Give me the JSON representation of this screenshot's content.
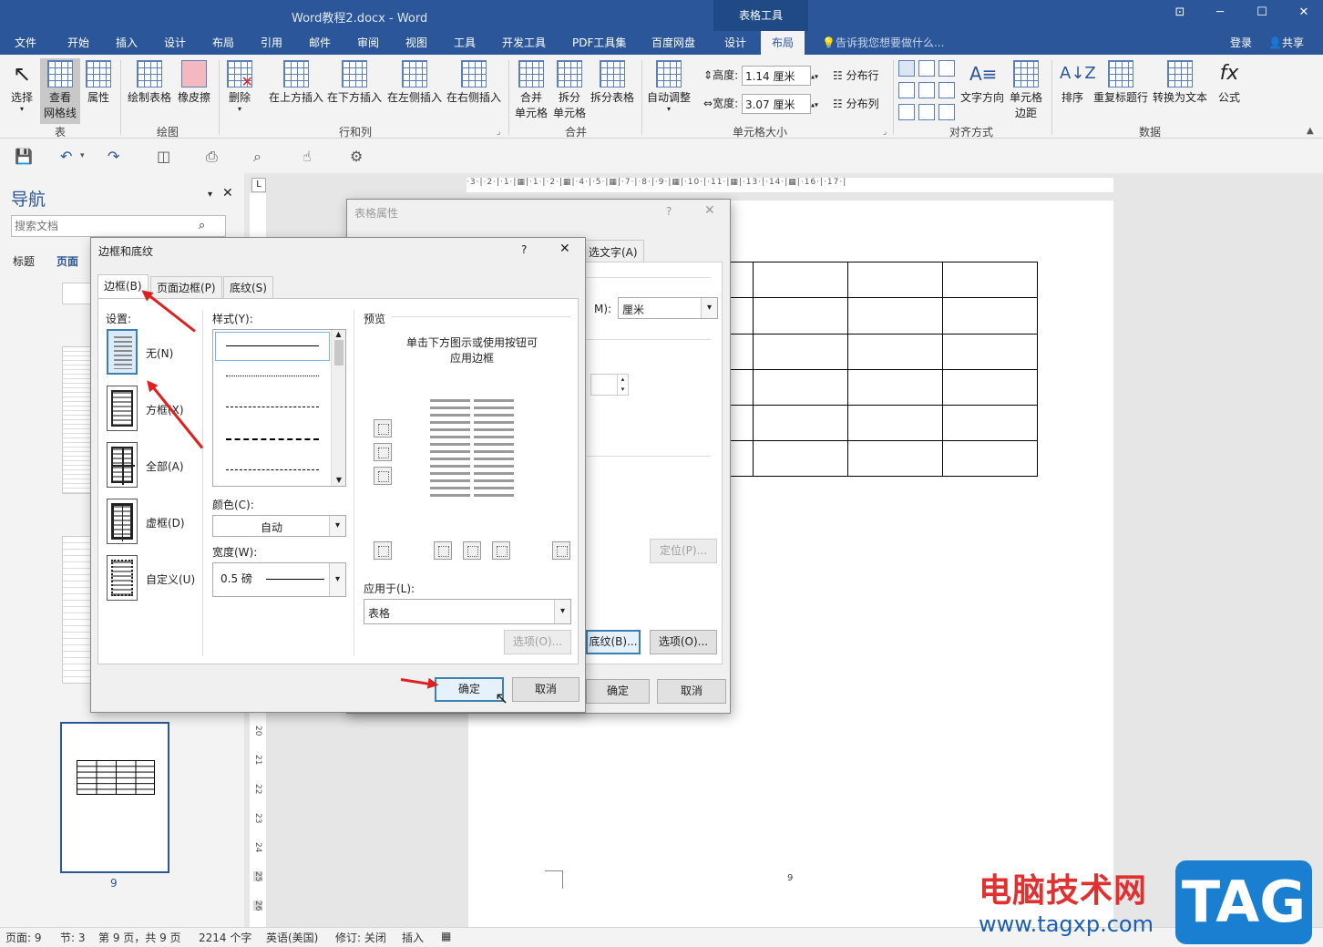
{
  "window": {
    "title": "Word教程2.docx - Word",
    "context_group": "表格工具",
    "login": "登录",
    "share": "共享"
  },
  "tabs": [
    "文件",
    "开始",
    "插入",
    "设计",
    "布局",
    "引用",
    "邮件",
    "审阅",
    "视图",
    "工具",
    "开发工具",
    "PDF工具集",
    "百度网盘",
    "设计",
    "布局"
  ],
  "tell_me": "告诉我您想要做什么...",
  "ribbon": {
    "select": "选择",
    "gridlines_l1": "查看",
    "gridlines_l2": "网格线",
    "properties": "属性",
    "draw_table": "绘制表格",
    "eraser": "橡皮擦",
    "delete": "删除",
    "insert_above": "在上方插入",
    "insert_below": "在下方插入",
    "insert_left": "在左侧插入",
    "insert_right": "在右侧插入",
    "merge_l1": "合并",
    "merge_l2": "单元格",
    "split_l1": "拆分",
    "split_l2": "单元格",
    "split_table": "拆分表格",
    "autofit": "自动调整",
    "height_label": "高度:",
    "height_value": "1.14 厘米",
    "width_label": "宽度:",
    "width_value": "3.07 厘米",
    "distribute_rows": "分布行",
    "distribute_cols": "分布列",
    "text_direction": "文字方向",
    "cell_margins_l1": "单元格",
    "cell_margins_l2": "边距",
    "sort": "排序",
    "repeat_header": "重复标题行",
    "convert_text": "转换为文本",
    "formula": "公式",
    "groups": {
      "table": "表",
      "draw": "绘图",
      "rows_cols": "行和列",
      "merge": "合并",
      "cell_size": "单元格大小",
      "alignment": "对齐方式",
      "data": "数据"
    }
  },
  "nav": {
    "title": "导航",
    "search_placeholder": "搜索文档",
    "tab_headings": "标题",
    "tab_pages": "页面",
    "page_number": "9"
  },
  "ruler_text": "·3·|·2·|·1·|▦|·1·|·2·|▦|·4·|·5·|▦|·7·|·8·|·9·|▦|·10·|·11·|▦|·13·|·14·|▦|·16·|·17·|",
  "vruler_labels": [
    "20",
    "21",
    "22",
    "23",
    "24",
    "25",
    "26"
  ],
  "page_footer": "9",
  "table_props": {
    "title": "表格属性",
    "help": "?",
    "tab_alt_text": "选文字(A)",
    "unit_label": "M):",
    "unit_value": "厘米",
    "position_btn": "定位(P)...",
    "borders_btn": "底纹(B)...",
    "options_btn": "选项(O)...",
    "ok": "确定",
    "cancel": "取消"
  },
  "borders_dialog": {
    "title": "边框和底纹",
    "help": "?",
    "tabs": [
      "边框(B)",
      "页面边框(P)",
      "底纹(S)"
    ],
    "setting_label": "设置:",
    "settings": [
      "无(N)",
      "方框(X)",
      "全部(A)",
      "虚框(D)",
      "自定义(U)"
    ],
    "style_label": "样式(Y):",
    "color_label": "颜色(C):",
    "color_value": "自动",
    "width_label": "宽度(W):",
    "width_value": "0.5 磅",
    "preview_label": "预览",
    "preview_hint_l1": "单击下方图示或使用按钮可",
    "preview_hint_l2": "应用边框",
    "apply_label": "应用于(L):",
    "apply_value": "表格",
    "options_btn": "选项(O)...",
    "ok": "确定",
    "cancel": "取消"
  },
  "status": {
    "page": "页面: 9",
    "section": "节: 3",
    "page_of": "第 9 页，共 9 页",
    "words": "2214 个字",
    "lang": "英语(美国)",
    "track": "修订: 关闭",
    "insert": "插入"
  },
  "watermark": {
    "site_cn": "电脑技术网",
    "site_url": "www.tagxp.com",
    "logo": "TAG"
  },
  "colors": {
    "brand": "#2b579a",
    "arrow": "#e02020"
  }
}
